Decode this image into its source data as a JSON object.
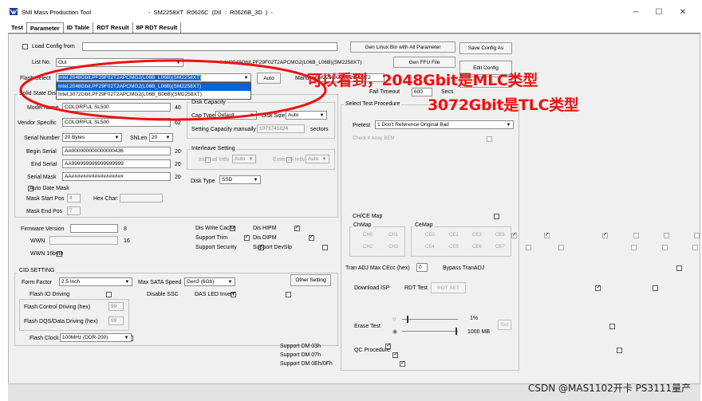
{
  "window": {
    "title": "SMI Mass Production Tool",
    "info": "- SM2258XT   R0626C   (DII : R0626B_3D ) -",
    "minimize": "─",
    "maximize": "☐",
    "close": "✕"
  },
  "tabs": [
    "Test",
    "Parameter",
    "ID Table",
    "RDT Result",
    "8P RDT Result"
  ],
  "top": {
    "load_config_label": "Load Config from",
    "gen_linux_bin": "Gen Linux Bin with All Parameter",
    "save_config": "Save Config As",
    "list_no_label": "List No.",
    "list_no_value": "Out",
    "flash_info_text": "Intel2048Gbit,PF29F02T2APCMG2(L06B_L06B)(SM2258XT)",
    "gen_ffu_file": "Gen FFU File",
    "edit_config": "Edit Config",
    "flash_select_label": "Flash Select",
    "flash_select_value": "Intel,2048Gbit,PF29F02T2APCMG2(L06B_L06B)(SM2258XT)",
    "auto_button": "Auto",
    "manu_label": "Manu",
    "manu_value": "SM2258XT: PF29F02T2",
    "fail_timeout_label": "Fail Timeout",
    "fail_timeout_value": "600",
    "secs_label": "Secs",
    "dropdown_options": [
      "Intel,2048Gbit,PF29F02T2APCMG2(L06B_L06B)(SM2258XT)",
      "Intel,3072Gbit,PF29F02T2APCMG2(L06B_B06B)(SM2258XT)"
    ]
  },
  "solid_state": {
    "title": "Solid State Dis",
    "model_name_label": "Model Name",
    "model_name_value": "COLORFUL SL500",
    "model_name_len": "40",
    "vendor_specific_label": "Vendor Specific",
    "vendor_specific_value": "COLORFUL SL500",
    "vendor_specific_len": "62",
    "serial_number_label": "Serial Number",
    "serial_number_value": "20 Bytes",
    "snlen_label": "SNLen",
    "snlen_value": "20",
    "begin_serial_label": "Begin Serial",
    "begin_serial_value": "AA000000000000000436",
    "begin_serial_len": "20",
    "end_serial_label": "End Serial",
    "end_serial_value": "AA999999999999999999",
    "end_serial_len": "20",
    "serial_mask_label": "Serial Mask",
    "serial_mask_value": "AA##################",
    "serial_mask_len": "20",
    "auto_date_mask": "Auto Date Mask",
    "mask_start_pos_label": "Mask Start Pos",
    "mask_start_pos_value": "4",
    "hex_char_label": "Hex Char:",
    "mask_end_pos_label": "Mask End Pos",
    "mask_end_pos_value": "7"
  },
  "disk_capacity": {
    "title": "Disk Capacity",
    "cap_type_label": "Cap Type",
    "cap_type_value": "Default",
    "disk_size_label": "Disk Size",
    "disk_size_value": "Auto",
    "setting_capacity_label": "Setting Capacity manually",
    "setting_capacity_value": "1073741824",
    "sectors_label": "sectors"
  },
  "interleave": {
    "title": "Interleave Setting",
    "internal_label": "Internal Intlv",
    "internal_value": "Auto",
    "external_label": "External Intlv",
    "external_value": "Auto",
    "disk_type_label": "Disk Type",
    "disk_type_value": "SSD"
  },
  "firmware": {
    "firmware_version_label": "Firmware Version",
    "firmware_version_len": "8",
    "wwn_label": "WWN",
    "wwn_len": "16",
    "wwn16_label": "WWN 16byte"
  },
  "features": {
    "dis_write_cache": "Dis Write Cache",
    "dis_hipm": "Dis HIPM",
    "support_trim": "Support Trim",
    "dis_dipm": "Dis DIPM",
    "support_security": "Support Security",
    "support_devslp": "Support DevSlp"
  },
  "cid": {
    "title": "CID SETTING",
    "form_factor_label": "Form Factor",
    "form_factor_value": "2.5 Inch",
    "max_sata_label": "Max SATA Speed",
    "max_sata_value": "Gen3 (6Gb)",
    "other_setting": "Other Setting",
    "flash_io_driving": "Flash IO Driving",
    "disable_ssc": "Disable SSC",
    "das_led_invert": "DAS LED Invert",
    "flash_control_label": "Flash Control Driving (hex)",
    "flash_control_value": "99",
    "flash_dqs_label": "Flash DQS/Data Driving (hex)",
    "flash_dqs_value": "99",
    "flash_clock_label": "Flash Clock",
    "flash_clock_value": "100MHz (DDR-200)",
    "support_dm03h": "Support DM 03h",
    "support_dm07h": "Support DM 07h",
    "support_dm0eh": "Support DM 0Eh/0Fh"
  },
  "test_procedure": {
    "title": "Select Test Procedure",
    "pretest_label": "Pretest",
    "pretest_value": "1  Don't Reference Original Bad",
    "check_4k": "Check 4 Array BEM",
    "chce_map": "CH/CE Map",
    "chmap_title": "ChMap",
    "cemap_title": "CeMap",
    "ch_labels": [
      "CH0",
      "CH1",
      "CH2",
      "CH3"
    ],
    "ce_labels": [
      "CE0",
      "CE1",
      "CE2",
      "CE3",
      "CE4",
      "CE5",
      "CE6",
      "CE7"
    ],
    "tran_adj_label": "Tran ADJ Max CEcc (hex)",
    "tran_adj_value": "0",
    "bypass_tranadj": "Bypass TranADJ",
    "download_isp": "Download ISP",
    "rdt_test": "RDT Test",
    "rdt_set": "RDT SET",
    "erase_test": "Erase Test",
    "pct_value": "1%",
    "mb_value": "1000 MB",
    "set_button": "Set",
    "qc_procedure": "QC Procedure"
  },
  "annotation": {
    "line1": "可以看到，2048Gbit是MLC类型",
    "line2": "3072Gbit是TLC类型"
  },
  "watermark": "CSDN @MAS1102开卡 PS3111量产",
  "colors": {
    "annotation": "#ee1111",
    "selection": "#0a64d6",
    "panel": "#f0f0f0"
  }
}
